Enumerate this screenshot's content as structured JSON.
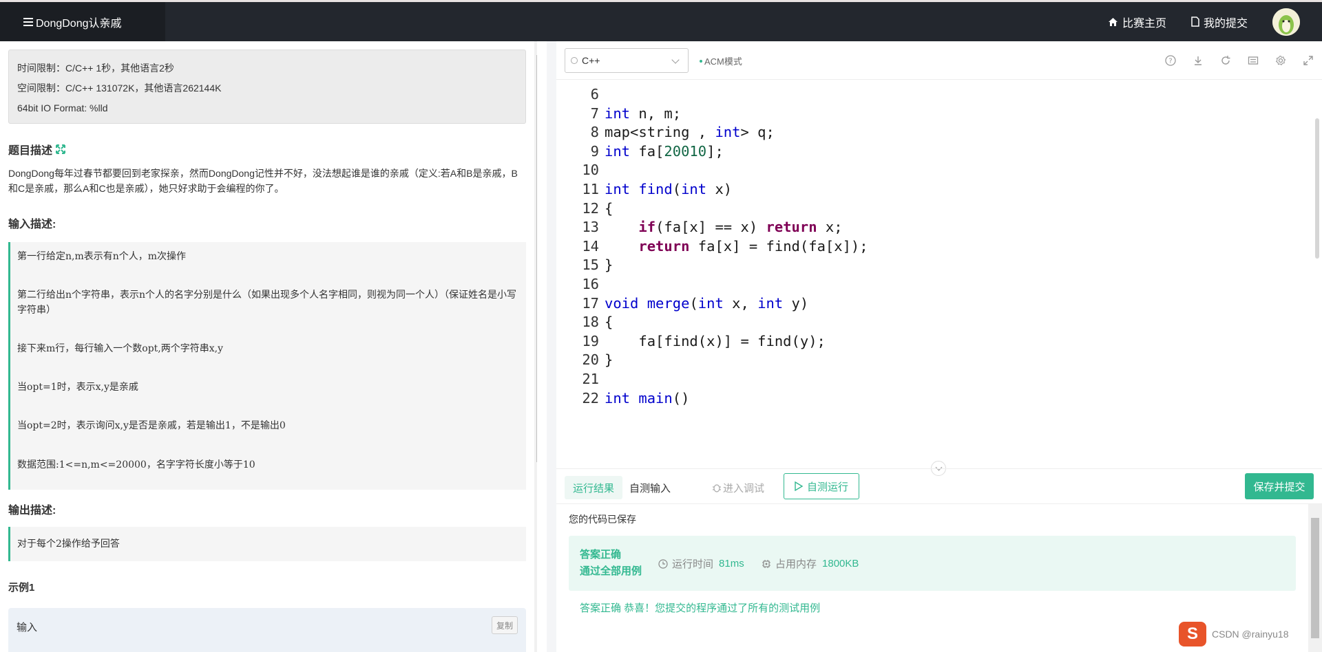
{
  "nav": {
    "brand": "DongDong认亲戚",
    "links": [
      "比赛主页",
      "我的提交"
    ]
  },
  "problem": {
    "limits": [
      "时间限制：C/C++ 1秒，其他语言2秒",
      "空间限制：C/C++ 131072K，其他语言262144K",
      "64bit IO Format: %lld"
    ],
    "desc_title": "题目描述",
    "description": "DongDong每年过春节都要回到老家探亲，然而DongDong记性并不好，没法想起谁是谁的亲戚（定义:若A和B是亲戚，B和C是亲戚，那么A和C也是亲戚），她只好求助于会编程的你了。",
    "input_title": "输入描述:",
    "input_lines": [
      "第一行给定n,m表示有n个人，m次操作",
      "第二行给出n个字符串，表示n个人的名字分别是什么（如果出现多个人名字相同，则视为同一个人）（保证姓名是小写字符串）",
      "接下来m行，每行输入一个数opt,两个字符串x,y",
      "当opt=1时，表示x,y是亲戚",
      "当opt=2时，表示询问x,y是否是亲戚，若是输出1，不是输出0",
      "数据范围:1<=n,m<=20000，名字字符长度小等于10"
    ],
    "output_title": "输出描述:",
    "output_text": "对于每个2操作给予回答",
    "example_title": "示例1",
    "sample_label": "输入",
    "copy_label": "复制"
  },
  "editor": {
    "language": "C++",
    "mode": "ACM模式",
    "lines": [
      {
        "n": "6",
        "tokens": []
      },
      {
        "n": "7",
        "tokens": [
          [
            "t",
            "int"
          ],
          [
            "p",
            " n, m;"
          ]
        ]
      },
      {
        "n": "8",
        "tokens": [
          [
            "p",
            "map<string , "
          ],
          [
            "t",
            "int"
          ],
          [
            "p",
            "> q;"
          ]
        ]
      },
      {
        "n": "9",
        "tokens": [
          [
            "t",
            "int"
          ],
          [
            "p",
            " fa["
          ],
          [
            "num",
            "20010"
          ],
          [
            "p",
            "];"
          ]
        ]
      },
      {
        "n": "10",
        "tokens": []
      },
      {
        "n": "11",
        "tokens": [
          [
            "t",
            "int"
          ],
          [
            "p",
            " "
          ],
          [
            "f",
            "find"
          ],
          [
            "p",
            "("
          ],
          [
            "t",
            "int"
          ],
          [
            "p",
            " x)"
          ]
        ]
      },
      {
        "n": "12",
        "tokens": [
          [
            "p",
            "{"
          ]
        ]
      },
      {
        "n": "13",
        "tokens": [
          [
            "p",
            "    "
          ],
          [
            "c",
            "if"
          ],
          [
            "p",
            "(fa[x] == x) "
          ],
          [
            "c",
            "return"
          ],
          [
            "p",
            " x;"
          ]
        ]
      },
      {
        "n": "14",
        "tokens": [
          [
            "p",
            "    "
          ],
          [
            "c",
            "return"
          ],
          [
            "p",
            " fa[x] = find(fa[x]);"
          ]
        ]
      },
      {
        "n": "15",
        "tokens": [
          [
            "p",
            "}"
          ]
        ]
      },
      {
        "n": "16",
        "tokens": []
      },
      {
        "n": "17",
        "tokens": [
          [
            "t",
            "void"
          ],
          [
            "p",
            " "
          ],
          [
            "f",
            "merge"
          ],
          [
            "p",
            "("
          ],
          [
            "t",
            "int"
          ],
          [
            "p",
            " x, "
          ],
          [
            "t",
            "int"
          ],
          [
            "p",
            " y)"
          ]
        ]
      },
      {
        "n": "18",
        "tokens": [
          [
            "p",
            "{"
          ]
        ]
      },
      {
        "n": "19",
        "tokens": [
          [
            "p",
            "    fa[find(x)] = find(y);"
          ]
        ]
      },
      {
        "n": "20",
        "tokens": [
          [
            "p",
            "}"
          ]
        ]
      },
      {
        "n": "21",
        "tokens": []
      },
      {
        "n": "22",
        "tokens": [
          [
            "t",
            "int"
          ],
          [
            "p",
            " "
          ],
          [
            "f",
            "main"
          ],
          [
            "p",
            "()"
          ]
        ]
      }
    ]
  },
  "result": {
    "tabs": [
      "运行结果",
      "自测输入",
      "进入调试"
    ],
    "run_label": "自测运行",
    "submit_label": "保存并提交",
    "saved": "您的代码已保存",
    "verdict_line1": "答案正确",
    "verdict_line2": "通过全部用例",
    "time_label": "运行时间",
    "time_value": "81ms",
    "mem_label": "占用内存",
    "mem_value": "1800KB",
    "congrats": "答案正确 恭喜！您提交的程序通过了所有的测试用例"
  },
  "ime": {
    "logo": "S",
    "watermark": "CSDN @rainyu18"
  },
  "colors": {
    "accent": "#32b890",
    "nav_bg": "#23272e"
  }
}
